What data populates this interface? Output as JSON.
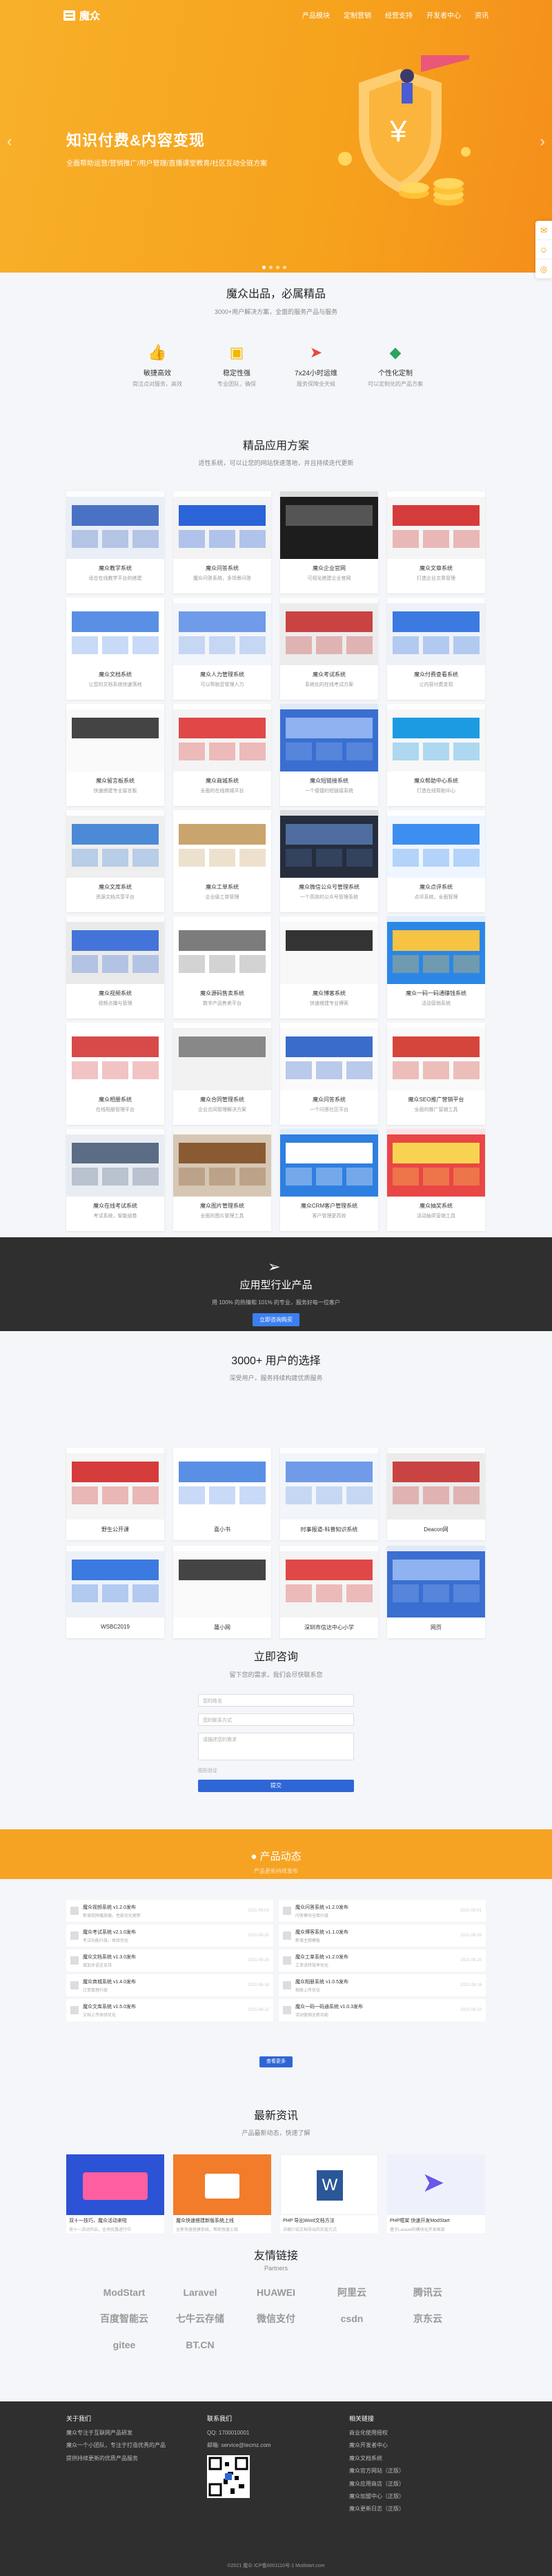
{
  "header": {
    "brand": "魔众",
    "nav": [
      "产品模块",
      "定制营销",
      "经营支持",
      "开发者中心",
      "资讯"
    ]
  },
  "hero": {
    "title": "知识付费&内容变现",
    "subtitle": "全面帮助运营/营销推广/用户管理/直播课堂教育/社区互动全链方案"
  },
  "side_tools": [
    "chat-icon",
    "qq-icon",
    "wechat-icon"
  ],
  "intro": {
    "title": "魔众出品，必属精品",
    "subtitle": "3000+用户解决方案，全面的服务产品与服务",
    "features": [
      {
        "icon": "thumbs-up-icon",
        "title": "敏捷高效",
        "desc": "简洁点对服务，高效"
      },
      {
        "icon": "cube-icon",
        "title": "稳定性强",
        "desc": "专业团队，确保"
      },
      {
        "icon": "paper-plane-icon",
        "title": "7x24小时运维",
        "desc": "服务保障全天候"
      },
      {
        "icon": "tag-icon",
        "title": "个性化定制",
        "desc": "可以定制化的产品方案"
      }
    ]
  },
  "solutions": {
    "title": "精品应用方案",
    "subtitle": "适性系统，可以让您的网站快速落地，并且持续迭代更新",
    "items": [
      {
        "name": "魔众教学系统",
        "desc": "适合在线教学平台的搭建"
      },
      {
        "name": "魔众问答系统",
        "desc": "魔众问答系统，多场景问答"
      },
      {
        "name": "魔众企业官网",
        "desc": "可视化搭建企业官网"
      },
      {
        "name": "魔众文章系统",
        "desc": "打造企业文章管理"
      },
      {
        "name": "魔众文档系统",
        "desc": "让您的文档系统快速落地"
      },
      {
        "name": "魔众人力管理系统",
        "desc": "可以帮助您管理人力"
      },
      {
        "name": "魔众考试系统",
        "desc": "系统化的在线考试方案"
      },
      {
        "name": "魔众付费查看系统",
        "desc": "让内容付费变现"
      },
      {
        "name": "魔众留言板系统",
        "desc": "快速搭建专业留言板"
      },
      {
        "name": "魔众商城系统",
        "desc": "全面的在线商城平台"
      },
      {
        "name": "魔众短链接系统",
        "desc": "一个便捷的短链接系统"
      },
      {
        "name": "魔众帮助中心系统",
        "desc": "打造在线帮助中心"
      },
      {
        "name": "魔众文库系统",
        "desc": "资源文档共享平台"
      },
      {
        "name": "魔众工单系统",
        "desc": "企业级工单管理"
      },
      {
        "name": "魔众微信公众号管理系统",
        "desc": "一个高效的公众号管理系统"
      },
      {
        "name": "魔众点评系统",
        "desc": "点评系统，全面管理"
      },
      {
        "name": "魔众视频系统",
        "desc": "视频点播与管理"
      },
      {
        "name": "魔众源码售卖系统",
        "desc": "数字产品售卖平台"
      },
      {
        "name": "魔众博客系统",
        "desc": "快速搭建专业博客"
      },
      {
        "name": "魔众一码一码通赚钱系统",
        "desc": "活动营销系统"
      },
      {
        "name": "魔众相册系统",
        "desc": "在线相册管理平台"
      },
      {
        "name": "魔众合同管理系统",
        "desc": "企业合同管理解决方案"
      },
      {
        "name": "魔众问答系统",
        "desc": "一个问答社区平台"
      },
      {
        "name": "魔众SEO推广营销平台",
        "desc": "全面的推广营销工具"
      },
      {
        "name": "魔众在线考试系统",
        "desc": "考试系统，智能组卷"
      },
      {
        "name": "魔众图片管理系统",
        "desc": "全面的图片管理工具"
      },
      {
        "name": "魔众CRM客户管理系统",
        "desc": "客户管理更高效"
      },
      {
        "name": "魔众抽奖系统",
        "desc": "活动抽奖营销工具"
      }
    ]
  },
  "industry": {
    "title": "应用型行业产品",
    "desc": "用 100% 的热情和 101% 的专业，服务好每一位客户",
    "button": "立即咨询购买"
  },
  "users": {
    "title": "3000+ 用户的选择",
    "subtitle": "深受用户，服务持续构建优质服务",
    "items": [
      "野生公开课",
      "喜小书",
      "时事报道-科普知识系统",
      "Deacon网",
      "WSBC2019",
      "莆小网",
      "深圳市信达中心小学",
      "网页"
    ]
  },
  "consult": {
    "title": "立即咨询",
    "subtitle": "留下您的需求，我们会尽快联系您",
    "fields": [
      "您的姓名",
      "您的联系方式",
      "请描述您的需求"
    ],
    "captcha": "图形验证",
    "submit": "提交"
  },
  "news": {
    "title": "产品动态",
    "subtitle": "产品更新持续发布",
    "left": [
      {
        "title": "魔众视频系统 v1.2.0发布",
        "desc": "新增视频播放器，性能优化更新",
        "date": "2021-09-01"
      },
      {
        "title": "魔众考试系统 v2.1.0发布",
        "desc": "考试功能升级，体验优化",
        "date": "2021-08-25"
      },
      {
        "title": "魔众文档系统 v1.3.0发布",
        "desc": "增加多语言支持",
        "date": "2021-08-20"
      },
      {
        "title": "魔众商城系统 v1.4.0发布",
        "desc": "订单管理升级",
        "date": "2021-08-18"
      },
      {
        "title": "魔众文库系统 v1.5.0发布",
        "desc": "文档上传体验优化",
        "date": "2021-08-12"
      }
    ],
    "right": [
      {
        "title": "魔众问答系统 v1.2.0发布",
        "desc": "问答模块全面升级",
        "date": "2021-09-01"
      },
      {
        "title": "魔众博客系统 v1.1.0发布",
        "desc": "新增主题模板",
        "date": "2021-08-26"
      },
      {
        "title": "魔众工单系统 v1.2.0发布",
        "desc": "工单流转效率优化",
        "date": "2021-08-20"
      },
      {
        "title": "魔众相册系统 v1.0.5发布",
        "desc": "相册上传优化",
        "date": "2021-08-16"
      },
      {
        "title": "魔众一码一码通系统 v1.0.3发布",
        "desc": "活动营销全新功能",
        "date": "2021-08-10"
      }
    ],
    "more": "查看更多"
  },
  "articles": {
    "title": "最新资讯",
    "subtitle": "产品最新动态，快速了解",
    "items": [
      {
        "title": "双十一技巧，魔众活动来啦",
        "desc": "双十一活动开启，全场优惠进行中"
      },
      {
        "title": "魔众快速搭建新版系统上线",
        "desc": "全新快速搭建系统，帮助快速上线"
      },
      {
        "title": "PHP 导出Word文档方法",
        "desc": "详细介绍文档导出的实现方式"
      },
      {
        "title": "PHP框架 快速开发ModStart",
        "desc": "基于Laravel的模块化开发框架"
      }
    ]
  },
  "partners": {
    "title": "友情链接",
    "subtitle": "Partners",
    "items": [
      "ModStart",
      "Laravel",
      "HUAWEI",
      "阿里云",
      "腾讯云",
      "百度智能云",
      "七牛云存储",
      "微信支付",
      "csdn",
      "京东云",
      "gitee",
      "BT.CN"
    ]
  },
  "footer": {
    "about_title": "关于我们",
    "about": [
      "魔众专注于互联网产品研发",
      "魔众一个小团队，专注于打造优秀的产品",
      "提供持续更新的优质产品服务"
    ],
    "contact_title": "联系我们",
    "contact": [
      "QQ: 1700010001",
      "邮箱: service@tecmz.com"
    ],
    "links_title": "相关链接",
    "links": [
      "商业化使用授权",
      "魔众开发者中心",
      "魔众文档系统",
      "魔众官方网站（正版）",
      "魔众应用商店（正版）",
      "魔众加盟中心（正版）",
      "魔众更新日志（正版）"
    ],
    "copyright": "©2021 魔众 ICP备0001110号-1 Modstart.com"
  }
}
